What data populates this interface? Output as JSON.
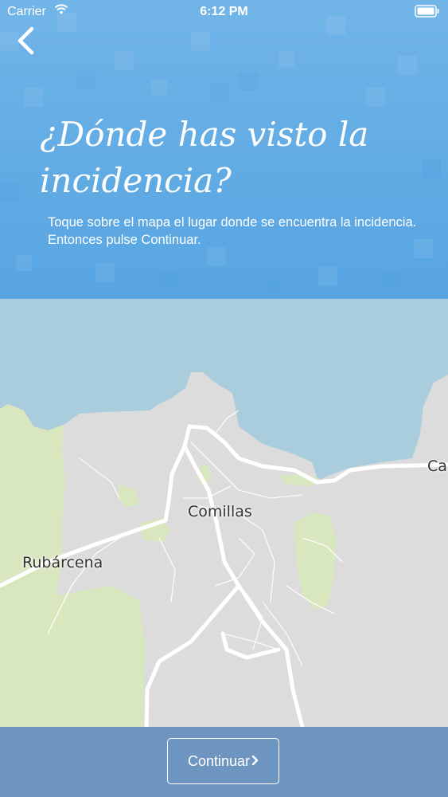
{
  "status_bar": {
    "carrier": "Carrier",
    "time": "6:12 PM"
  },
  "header": {
    "back_icon": "chevron-left-icon",
    "title": "¿Dónde has visto la incidencia?",
    "subtitle": "Toque sobre el mapa el lugar donde se encuentra la incidencia. Entonces pulse Continuar."
  },
  "map": {
    "labels": {
      "town": "Comillas",
      "village": "Rubárcena",
      "edge": "Ca"
    },
    "colors": {
      "sea": "#aacddd",
      "land": "#dcdcdc",
      "park": "#d9e7bf",
      "road": "#ffffff"
    }
  },
  "footer": {
    "continue_label": "Continuar",
    "continue_icon": "chevron-right-icon"
  }
}
